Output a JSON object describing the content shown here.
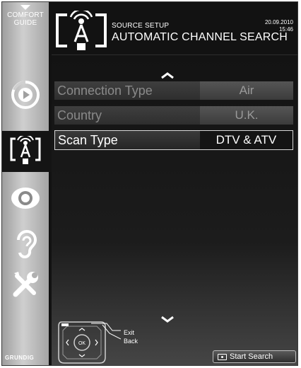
{
  "sidebar": {
    "header_label_line1": "COMFORT",
    "header_label_line2": "GUIDE",
    "brand": "GRUNDIG",
    "items": [
      {
        "name": "media-icon"
      },
      {
        "name": "source-setup-icon",
        "active": true
      },
      {
        "name": "picture-eye-icon"
      },
      {
        "name": "sound-ear-icon"
      },
      {
        "name": "settings-tools-icon"
      }
    ]
  },
  "header": {
    "subtitle": "SOURCE SETUP",
    "title": "AUTOMATIC CHANNEL SEARCH",
    "date": "20.09.2010",
    "time": "15:46"
  },
  "menu": {
    "rows": [
      {
        "label": "Connection Type",
        "value": "Air"
      },
      {
        "label": "Country",
        "value": "U.K."
      },
      {
        "label": "Scan Type",
        "value": "DTV & ATV",
        "selected": true
      }
    ]
  },
  "footer": {
    "navpad_center": "OK",
    "exit_label": "Exit",
    "back_label": "Back",
    "start_button_label": "Start Search"
  },
  "colors": {
    "background": "#121212",
    "sidebar": "#bdbdbd",
    "text": "#ffffff",
    "text_dim": "#8a8a8a",
    "selected_border": "#d8d8d8"
  }
}
